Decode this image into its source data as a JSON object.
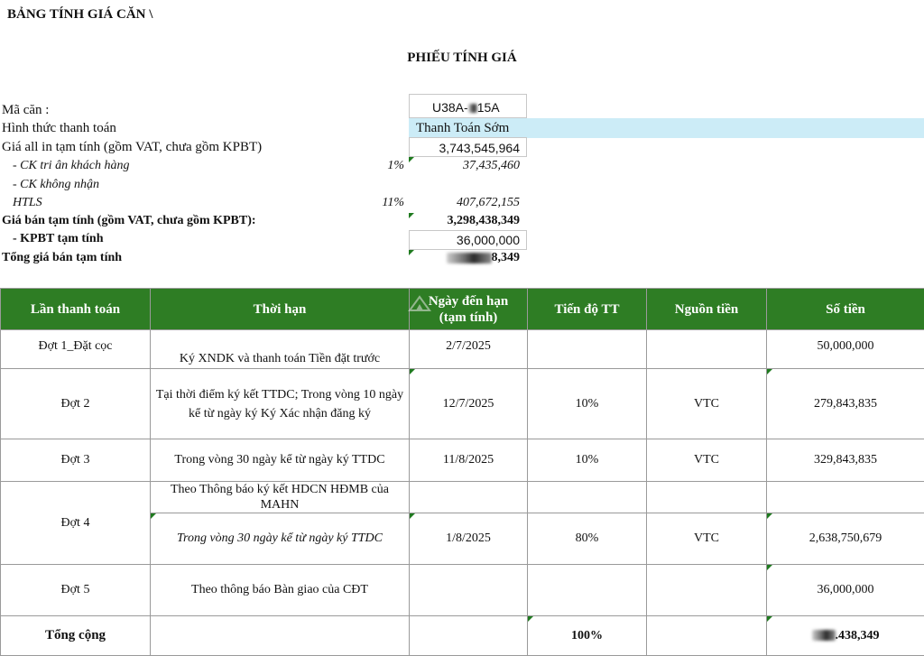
{
  "sheet_title": "BẢNG TÍNH GIÁ CĂN \\",
  "doc_title": "PHIẾU TÍNH GIÁ",
  "info": {
    "ma_can_label": "Mã căn :",
    "ma_can_value": "U38A-",
    "ma_can_suffix": "15A",
    "hinh_thuc_label": "Hình thức thanh toán",
    "hinh_thuc_value": "Thanh Toán Sớm",
    "gia_all_in_label": "Giá all in tạm tính (gồm VAT, chưa gồm KPBT)",
    "gia_all_in_value": "3,743,545,964",
    "ck_tri_an_label": "- CK tri ân khách hàng",
    "ck_tri_an_pct": "1%",
    "ck_tri_an_value": "37,435,460",
    "ck_khong_nhan_label": "- CK không nhận",
    "htls_label": "HTLS",
    "htls_pct": "11%",
    "htls_value": "407,672,155",
    "gia_ban_label": "Giá bán tạm tính (gồm VAT, chưa gồm KPBT):",
    "gia_ban_value": "3,298,438,349",
    "kpbt_label": "- KPBT tạm tính",
    "kpbt_value": "36,000,000",
    "tong_gia_label": "Tổng giá bán tạm tính",
    "tong_gia_value_visible": "8,349"
  },
  "table": {
    "headers": [
      "Lần thanh toán",
      "Thời hạn",
      "Ngày đến hạn (tạm tính)",
      "Tiến độ TT",
      "Nguồn tiền",
      "Số tiền"
    ],
    "watermark_text": "PropertyGuru",
    "rows": [
      {
        "lan": "Đợt 1_Đặt cọc",
        "thoi_han": "Ký XNDK và thanh toán Tiền đặt trước",
        "ngay": "2/7/2025",
        "tien_do": "",
        "nguon": "",
        "so_tien": "50,000,000"
      },
      {
        "lan": "Đợt 2",
        "thoi_han": "Tại thời điểm ký kết TTDC; Trong vòng 10 ngày kể từ ngày ký Ký Xác nhận đăng ký",
        "ngay": "12/7/2025",
        "tien_do": "10%",
        "nguon": "VTC",
        "so_tien": "279,843,835"
      },
      {
        "lan": "Đợt 3",
        "thoi_han": "Trong vòng 30 ngày kể từ ngày ký TTDC",
        "ngay": "11/8/2025",
        "tien_do": "10%",
        "nguon": "VTC",
        "so_tien": "329,843,835"
      },
      {
        "lan": "Đợt 4",
        "thoi_han_a": "Theo Thông báo ký kết HDCN HĐMB của MAHN",
        "thoi_han_b": "Trong vòng 30 ngày kể từ ngày ký TTDC",
        "ngay": "1/8/2025",
        "tien_do": "80%",
        "nguon": "VTC",
        "so_tien": "2,638,750,679"
      },
      {
        "lan": "Đợt 5",
        "thoi_han": "Theo thông báo Bàn giao của CĐT",
        "ngay": "",
        "tien_do": "",
        "nguon": "",
        "so_tien": "36,000,000"
      }
    ],
    "total": {
      "label": "Tổng cộng",
      "tien_do": "100%",
      "so_tien_visible": ".438,349"
    }
  },
  "colors": {
    "header_green": "#2e7d24",
    "highlight_blue": "#ccecf7",
    "marker_green": "#1f7a1f"
  }
}
